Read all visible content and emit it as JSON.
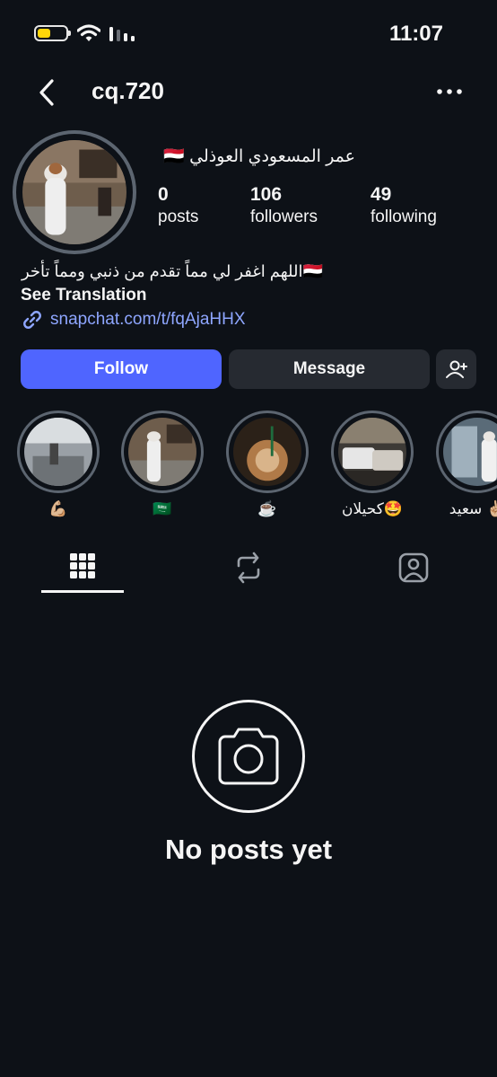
{
  "status_bar": {
    "time": "11:07",
    "battery_color": "#ffd60a"
  },
  "header": {
    "username": "cq.720"
  },
  "profile": {
    "full_name": "عمر المسعودي العوذلي 🇾🇪",
    "stats": [
      {
        "value": "0",
        "label": "posts"
      },
      {
        "value": "106",
        "label": "followers"
      },
      {
        "value": "49",
        "label": "following"
      }
    ],
    "bio": "اللهم اغفر لي مماً تقدم من ذنبي ومماً تأخر🇾🇪",
    "see_translation": "See Translation",
    "link": "snapchat.com/t/fqAjaHHX"
  },
  "buttons": {
    "follow": "Follow",
    "message": "Message"
  },
  "highlights": [
    {
      "caption": "💪🏼"
    },
    {
      "caption": "🇸🇦"
    },
    {
      "caption": "☕️"
    },
    {
      "caption": "كحيلان🤩"
    },
    {
      "caption": "سعيد ✌🏼"
    }
  ],
  "tabs": [
    "grid-icon",
    "reels-icon",
    "tagged-icon"
  ],
  "empty_state": {
    "text": "No posts yet"
  },
  "colors": {
    "accent": "#4f65ff",
    "background": "#0d1117",
    "link": "#8ea6ff"
  }
}
